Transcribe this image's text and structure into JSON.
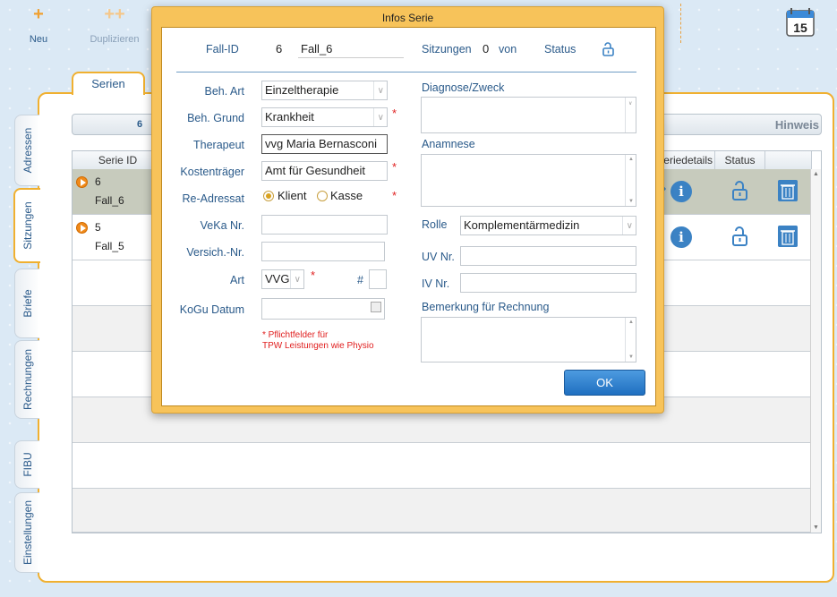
{
  "toolbar": {
    "new_label": "Neu",
    "duplicate_label": "Duplizieren"
  },
  "side_tabs": [
    "Adressen",
    "Sitzungen",
    "Briefe",
    "Rechnungen",
    "FIBU",
    "Einstellungen"
  ],
  "main_tab": "Serien",
  "filter": {
    "count": "6",
    "hint": "Hinweis"
  },
  "table": {
    "headers": {
      "serie_id": "Serie ID",
      "seriedetails": "eriedetails",
      "status": "Status"
    },
    "rows": [
      {
        "id": "6",
        "name": "Fall_6"
      },
      {
        "id": "5",
        "name": "Fall_5"
      }
    ]
  },
  "calendar_day": "15",
  "dialog": {
    "title": "Infos Serie",
    "fall_id_label": "Fall-ID",
    "fall_id_value": "6",
    "fall_name": "Fall_6",
    "sitzungen_label": "Sitzungen",
    "sitzungen_value": "0",
    "von_label": "von",
    "status_label": "Status",
    "beh_art_label": "Beh. Art",
    "beh_art_value": "Einzeltherapie",
    "beh_grund_label": "Beh. Grund",
    "beh_grund_value": "Krankheit",
    "therapeut_label": "Therapeut",
    "therapeut_value": "vvg Maria Bernasconi",
    "kostentraeger_label": "Kostenträger",
    "kostentraeger_value": "Amt für Gesundheit",
    "readressat_label": "Re-Adressat",
    "klient_label": "Klient",
    "kasse_label": "Kasse",
    "veka_label": "VeKa Nr.",
    "versich_label": "Versich.-Nr.",
    "art_label": "Art",
    "art_value": "VVG",
    "hash_label": "#",
    "kogu_label": "KoGu Datum",
    "hint_line1": "* Pflichtfelder für",
    "hint_line2": "TPW Leistungen wie Physio",
    "diagnose_label": "Diagnose/Zweck",
    "anamnese_label": "Anamnese",
    "rolle_label": "Rolle",
    "rolle_value": "Komplementärmedizin",
    "uv_label": "UV Nr.",
    "iv_label": "IV Nr.",
    "bemerkung_label": "Bemerkung für Rechnung",
    "ok_label": "OK",
    "required_mark": "*"
  }
}
